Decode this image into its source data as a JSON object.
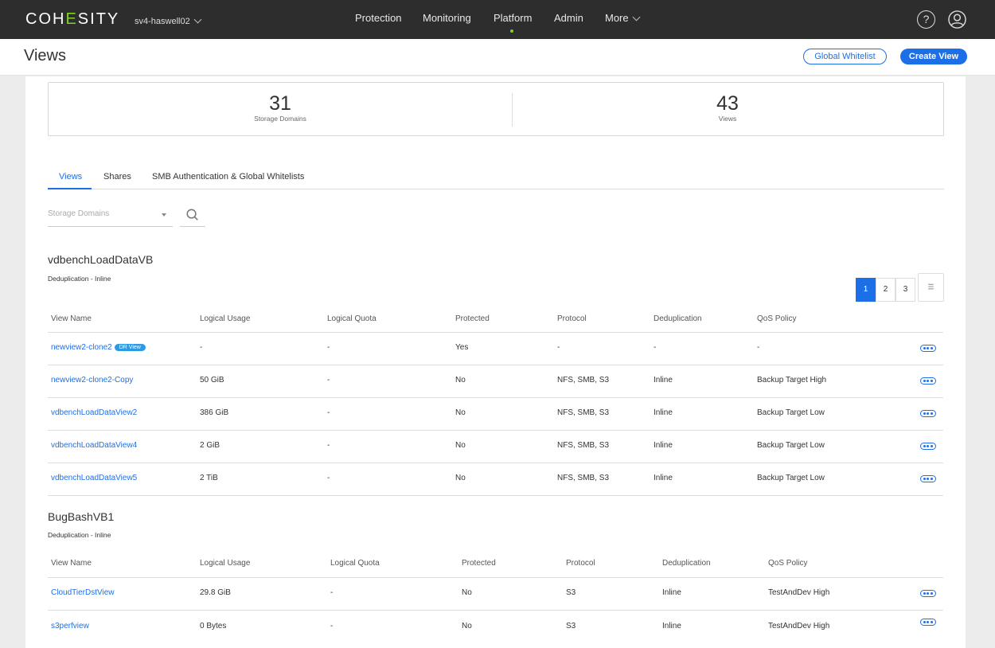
{
  "nav": {
    "logo_left": "COH",
    "logo_accent": "E",
    "logo_right": "SITY",
    "cluster": "sv4-haswell02",
    "items": [
      "Protection",
      "Monitoring",
      "Platform",
      "Admin",
      "More"
    ],
    "help": "?"
  },
  "header": {
    "title": "Views",
    "global_whitelist": "Global Whitelist",
    "create_view": "Create View"
  },
  "stats": [
    {
      "value": "31",
      "label": "Storage Domains"
    },
    {
      "value": "43",
      "label": "Views"
    }
  ],
  "tabs": [
    "Views",
    "Shares",
    "SMB Authentication & Global Whitelists"
  ],
  "filter": {
    "placeholder": "Storage Domains"
  },
  "pagination": [
    "1",
    "2",
    "3"
  ],
  "columns": [
    "View Name",
    "Logical Usage",
    "Logical Quota",
    "Protected",
    "Protocol",
    "Deduplication",
    "QoS Policy"
  ],
  "groups": [
    {
      "name": "vdbenchLoadDataVB",
      "subtitle": "Deduplication - Inline",
      "rows": [
        {
          "name": "newview2-clone2",
          "badge": "DR View",
          "usage": "-",
          "quota": "-",
          "protected": "Yes",
          "protocol": "-",
          "dedup": "-",
          "qos": "-"
        },
        {
          "name": "newview2-clone2-Copy",
          "usage": "50 GiB",
          "quota": "-",
          "protected": "No",
          "protocol": "NFS, SMB, S3",
          "dedup": "Inline",
          "qos": "Backup Target High"
        },
        {
          "name": "vdbenchLoadDataView2",
          "usage": "386 GiB",
          "quota": "-",
          "protected": "No",
          "protocol": "NFS, SMB, S3",
          "dedup": "Inline",
          "qos": "Backup Target Low"
        },
        {
          "name": "vdbenchLoadDataView4",
          "usage": "2 GiB",
          "quota": "-",
          "protected": "No",
          "protocol": "NFS, SMB, S3",
          "dedup": "Inline",
          "qos": "Backup Target Low"
        },
        {
          "name": "vdbenchLoadDataView5",
          "usage": "2 TiB",
          "quota": "-",
          "protected": "No",
          "protocol": "NFS, SMB, S3",
          "dedup": "Inline",
          "qos": "Backup Target Low"
        }
      ]
    },
    {
      "name": "BugBashVB1",
      "subtitle": "Deduplication - Inline",
      "rows": [
        {
          "name": "CloudTierDstView",
          "usage": "29.8 GiB",
          "quota": "-",
          "protected": "No",
          "protocol": "S3",
          "dedup": "Inline",
          "qos": "TestAndDev High"
        },
        {
          "name": "s3perfview",
          "usage": "0 Bytes",
          "quota": "-",
          "protected": "No",
          "protocol": "S3",
          "dedup": "Inline",
          "qos": "TestAndDev High"
        }
      ]
    }
  ],
  "colors": {
    "accent": "#1d6fe8",
    "brand_green": "#7ed321",
    "badge": "#2c9be6",
    "topbar": "#2d2d2d"
  }
}
